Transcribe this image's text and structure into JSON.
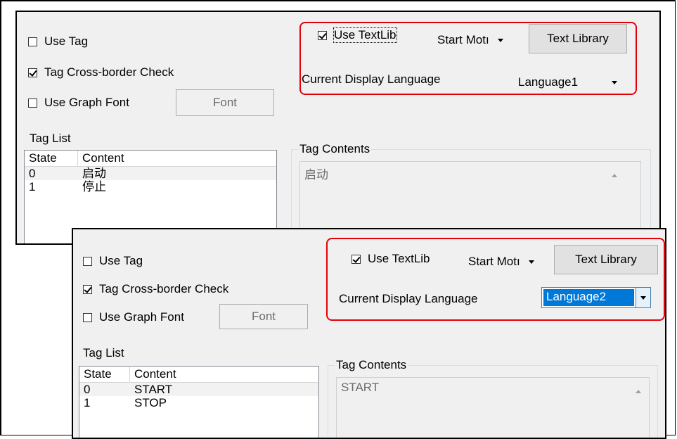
{
  "panel_top": {
    "use_tag": {
      "label": "Use Tag",
      "checked": false
    },
    "tag_cross_border": {
      "label": "Tag Cross-border Check",
      "checked": true
    },
    "use_graph_font": {
      "label": "Use Graph Font",
      "checked": false
    },
    "font_button": "Font",
    "use_textlib": {
      "label": "Use TextLib",
      "checked": true
    },
    "start_mode": "Start Motı",
    "text_library_button": "Text Library",
    "current_display_language_label": "Current Display Language",
    "current_display_language_value": "Language1",
    "tag_list_label": "Tag List",
    "tag_list_headers": [
      "State",
      "Content"
    ],
    "tag_list_rows": [
      {
        "state": "0",
        "content": "启动"
      },
      {
        "state": "1",
        "content": "停止"
      }
    ],
    "tag_contents_label": "Tag Contents",
    "tag_contents_value": "启动"
  },
  "panel_bottom": {
    "use_tag": {
      "label": "Use Tag",
      "checked": false
    },
    "tag_cross_border": {
      "label": "Tag Cross-border Check",
      "checked": true
    },
    "use_graph_font": {
      "label": "Use Graph Font",
      "checked": false
    },
    "font_button": "Font",
    "use_textlib": {
      "label": "Use TextLib",
      "checked": true
    },
    "start_mode": "Start Motı",
    "text_library_button": "Text Library",
    "current_display_language_label": "Current Display Language",
    "current_display_language_value": "Language2",
    "tag_list_label": "Tag List",
    "tag_list_headers": [
      "State",
      "Content"
    ],
    "tag_list_rows": [
      {
        "state": "0",
        "content": "START"
      },
      {
        "state": "1",
        "content": "STOP"
      }
    ],
    "tag_contents_label": "Tag Contents",
    "tag_contents_value": "START"
  },
  "colors": {
    "highlight_box": "#e3000b",
    "selection": "#0078d7",
    "dialog_bg": "#f0f0f0"
  }
}
